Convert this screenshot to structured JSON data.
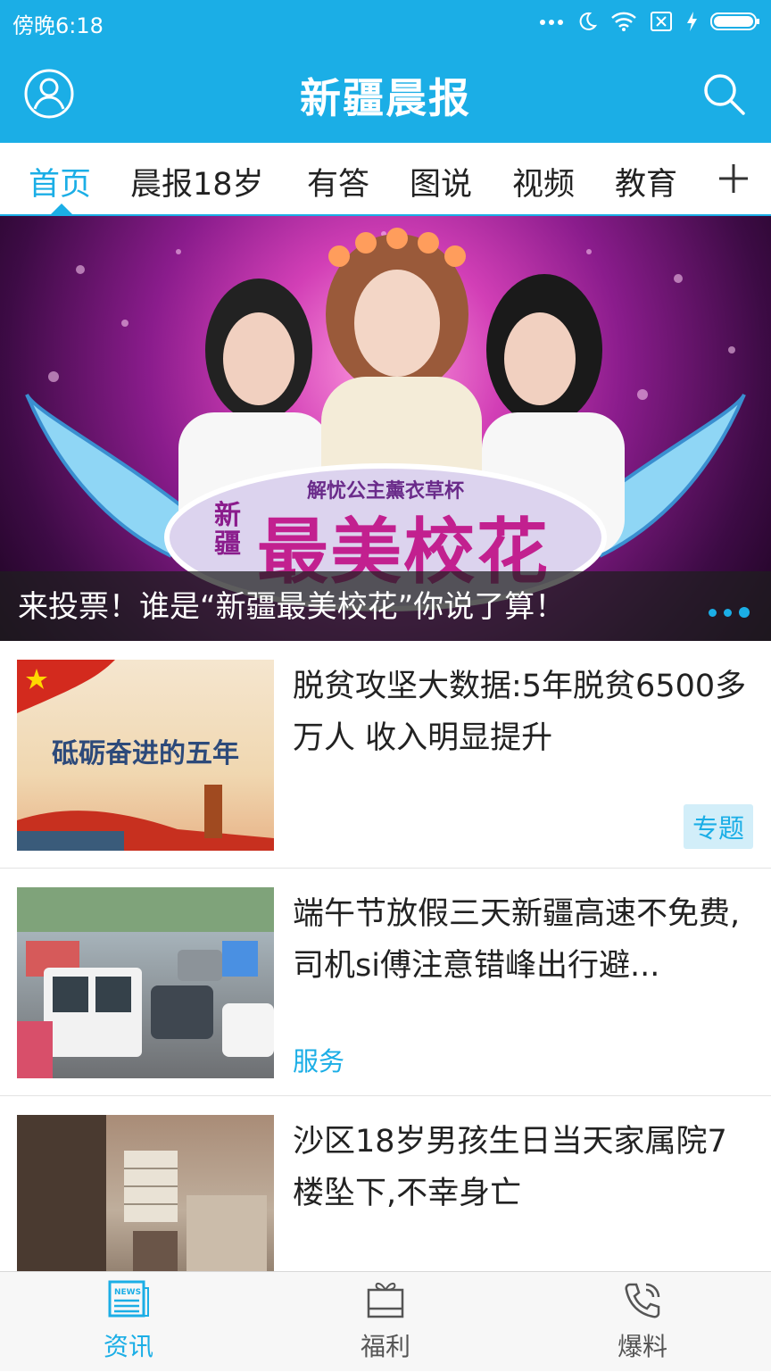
{
  "status_bar": {
    "time": "傍晚6:18"
  },
  "header": {
    "title": "新疆晨报"
  },
  "tabs": [
    {
      "label": "首页",
      "active": true
    },
    {
      "label": "晨报18岁",
      "active": false
    },
    {
      "label": "有答",
      "active": false
    },
    {
      "label": "图说",
      "active": false
    },
    {
      "label": "视频",
      "active": false
    },
    {
      "label": "教育",
      "active": false
    }
  ],
  "banner": {
    "subtitle": "解忧公主薰衣草杯",
    "logo_small": "新疆",
    "logo_big": "最美校花",
    "caption": "来投票！谁是“新疆最美校花”你说了算！"
  },
  "news": [
    {
      "headline": "脱贫攻坚大数据:5年脱贫6500多万人 收入明显提升",
      "tag": "专题",
      "thumb_text": "砥砺奋进的五年"
    },
    {
      "headline": "端午节放假三天新疆高速不免费,司机si傅注意错峰出行避...",
      "tag": "服务"
    },
    {
      "headline": "沙区18岁男孩生日当天家属院7楼坠下,不幸身亡",
      "tag": ""
    }
  ],
  "bottom_nav": [
    {
      "label": "资讯",
      "icon": "news-icon",
      "active": true
    },
    {
      "label": "福利",
      "icon": "gift-icon",
      "active": false
    },
    {
      "label": "爆料",
      "icon": "phone-icon",
      "active": false
    }
  ],
  "colors": {
    "accent": "#1baee6",
    "text": "#222222"
  }
}
